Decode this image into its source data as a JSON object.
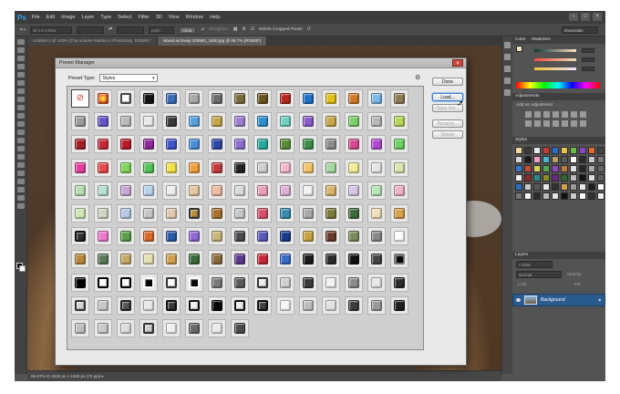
{
  "menubar": {
    "logo": "Ps",
    "items": [
      "File",
      "Edit",
      "Image",
      "Layer",
      "Type",
      "Select",
      "Filter",
      "3D",
      "View",
      "Window",
      "Help"
    ]
  },
  "optbar": {
    "size_value": "W x H x Res",
    "units": "px/in",
    "clear_label": "Clear",
    "straighten_label": "Straighten",
    "delete_cropped_label": "Delete Cropped Pixels",
    "workspace": "Essentials"
  },
  "tabs": [
    {
      "label": "Untitled-1 @ 100% (The Actions Palette in Photoshop, RGB/8) *"
    },
    {
      "label": "island archway 300582_1920.jpg @ 66.7% (RGB/8*)"
    }
  ],
  "status": {
    "text": "66.67%  ⊡  1920 px x 1280 px (72 ppi)  ▸"
  },
  "panels": {
    "color_tabs": [
      "Color",
      "Swatches"
    ],
    "adjustments_title": "Adjustments",
    "adjustments_hint": "Add an adjustment",
    "styles_title": "Styles",
    "layers_title": "Layers",
    "layers_kind": "⌕ Kind",
    "layers_blend": "Normal",
    "layers_opacity": "Opacity:",
    "layers_lock": "Lock:",
    "layers_fill": "Fill:",
    "layer_name": "Background"
  },
  "dialog": {
    "title": "Preset Manager",
    "preset_type_label": "Preset Type:",
    "preset_type_value": "Styles",
    "buttons": {
      "done": "Done",
      "load": "Load...",
      "save_set": "Save Set...",
      "rename": "Rename...",
      "delete": "Delete"
    },
    "presets": [
      {
        "kind": "none",
        "fill": "#ffffff"
      },
      {
        "fill": "#d8481f",
        "glow": "#ffd23a"
      },
      {
        "fill": "#ffffff",
        "border": "#444444"
      },
      {
        "fill": "#111111"
      },
      {
        "fill": "#3b6db5"
      },
      {
        "fill": "#a5a5a5"
      },
      {
        "fill": "#6e6e6e"
      },
      {
        "fill": "#7a6a3b"
      },
      {
        "fill": "#6a5420"
      },
      {
        "fill": "#b5261e"
      },
      {
        "fill": "#1f6fc7"
      },
      {
        "fill": "#e3c21a"
      },
      {
        "fill": "#d27a2a"
      },
      {
        "fill": "#7cb7e6"
      },
      {
        "fill": "#8e7a55"
      },
      {
        "fill": "#9c9c9c"
      },
      {
        "fill": "#6456c8"
      },
      {
        "fill": "#b9b9b9"
      },
      {
        "fill": "#eaeaea"
      },
      {
        "fill": "#3a3a3a"
      },
      {
        "fill": "#5aa0dc"
      },
      {
        "fill": "#c7a54a"
      },
      {
        "fill": "#9b7fd0"
      },
      {
        "fill": "#2e8fd0"
      },
      {
        "fill": "#6fd0c0"
      },
      {
        "fill": "#8a5cc8"
      },
      {
        "fill": "#c8a84a"
      },
      {
        "fill": "#7ed06a"
      },
      {
        "fill": "#b8b8b8"
      },
      {
        "fill": "#b6d65a"
      },
      {
        "fill": "#a31f2b"
      },
      {
        "fill": "#c7283a"
      },
      {
        "fill": "#b81a28"
      },
      {
        "fill": "#8c2a9a"
      },
      {
        "fill": "#3f54c8"
      },
      {
        "fill": "#4a8fd6"
      },
      {
        "fill": "#2b46a8"
      },
      {
        "fill": "#8c6fd0"
      },
      {
        "fill": "#2aa8a0"
      },
      {
        "fill": "#5b8c3a"
      },
      {
        "fill": "#3d8f4a"
      },
      {
        "fill": "#8d8d8d"
      },
      {
        "fill": "#d64a8f"
      },
      {
        "fill": "#b04ad0"
      },
      {
        "fill": "#6fd066"
      },
      {
        "fill": "#e53f9d"
      },
      {
        "fill": "#e94a4a"
      },
      {
        "fill": "#7fd65a"
      },
      {
        "fill": "#56c456"
      },
      {
        "fill": "#f2e34a"
      },
      {
        "fill": "#f0a03a"
      },
      {
        "fill": "#c43a3a"
      },
      {
        "fill": "#222222"
      },
      {
        "fill": "#cfcfcf"
      },
      {
        "fill": "#f5b8cf"
      },
      {
        "fill": "#f4c46a"
      },
      {
        "fill": "#a5d9a0"
      },
      {
        "fill": "#f4ee9a"
      },
      {
        "fill": "#e7e7e7"
      },
      {
        "fill": "#d9e8b0"
      },
      {
        "fill": "#b7dcb0"
      },
      {
        "fill": "#b7e0d2"
      },
      {
        "fill": "#c9a8d8"
      },
      {
        "fill": "#b7d4ef"
      },
      {
        "fill": "#eeeeee"
      },
      {
        "fill": "#e6c6a0"
      },
      {
        "fill": "#f0bca0"
      },
      {
        "fill": "#dadada"
      },
      {
        "fill": "#e9a0b8"
      },
      {
        "fill": "#e0b0d8"
      },
      {
        "fill": "#f2f2f2"
      },
      {
        "fill": "#dab36a"
      },
      {
        "fill": "#d8c8e6"
      },
      {
        "fill": "#b8e6b8"
      },
      {
        "fill": "#f0b2c8"
      },
      {
        "fill": "#cfe6b5"
      },
      {
        "fill": "#cfd6c0"
      },
      {
        "fill": "#b6c8e6"
      },
      {
        "fill": "#c6c6c6"
      },
      {
        "fill": "#e0cbb0"
      },
      {
        "fill": "#b98a3a",
        "border": "#333333"
      },
      {
        "fill": "#a6722e"
      },
      {
        "fill": "#c6c6c6"
      },
      {
        "fill": "#d6536a"
      },
      {
        "fill": "#3a8ab0"
      },
      {
        "fill": "#a9a9a9"
      },
      {
        "fill": "#7a7a3a"
      },
      {
        "fill": "#3c6a3c"
      },
      {
        "fill": "#f0e0b8"
      },
      {
        "fill": "#d6a24a"
      },
      {
        "fill": "#333333",
        "border": "#111111"
      },
      {
        "fill": "#f07ad0"
      },
      {
        "fill": "#5aa04a"
      },
      {
        "fill": "#d86a2a"
      },
      {
        "fill": "#2a5aa8"
      },
      {
        "fill": "#8f6ad0"
      },
      {
        "fill": "#c8b87a"
      },
      {
        "fill": "#4a4a4a"
      },
      {
        "fill": "#5a5ab8"
      },
      {
        "fill": "#1a3a8a"
      },
      {
        "fill": "#c8a040"
      },
      {
        "fill": "#6a3a2a"
      },
      {
        "fill": "#7a8a5a"
      },
      {
        "fill": "#888888"
      },
      {
        "fill": "#ffffff"
      },
      {
        "fill": "#b8863a"
      },
      {
        "fill": "#5a7a5a"
      },
      {
        "fill": "#c8a86a"
      },
      {
        "fill": "#e8e0b0"
      },
      {
        "fill": "#cfa050"
      },
      {
        "fill": "#3a6a3a"
      },
      {
        "fill": "#8a6a3a"
      },
      {
        "fill": "#5a3a8a"
      },
      {
        "fill": "#c8283a"
      },
      {
        "fill": "#3a6ac8"
      },
      {
        "fill": "#1a1a1a"
      },
      {
        "fill": "#2a2a2a"
      },
      {
        "fill": "#111111"
      },
      {
        "fill": "#444444"
      },
      {
        "fill": "#000000",
        "border": "#777777"
      },
      {
        "fill": "#000000"
      },
      {
        "fill": "#ffffff",
        "border": "#000000"
      },
      {
        "fill": "#ffffff",
        "border": "#000000"
      },
      {
        "fill": "#000000",
        "border": "#ffffff"
      },
      {
        "fill": "#ffffff",
        "border": "#333333"
      },
      {
        "fill": "#000000",
        "border": "#ffffff"
      },
      {
        "fill": "#7a7a7a"
      },
      {
        "fill": "#5a5a5a"
      },
      {
        "fill": "#eeeeee",
        "border": "#333333"
      },
      {
        "fill": "#d0d0d0"
      },
      {
        "fill": "#3a3a3a"
      },
      {
        "fill": "#f2f2f2"
      },
      {
        "fill": "#8c8c8c"
      },
      {
        "fill": "#e6e6e6"
      },
      {
        "fill": "#2a2a2a"
      },
      {
        "fill": "#d6d6d6",
        "border": "#333333"
      },
      {
        "fill": "#c8c8c8"
      },
      {
        "fill": "#555555",
        "border": "#222222"
      },
      {
        "fill": "#e8e8e8"
      },
      {
        "fill": "#3a3a3a",
        "border": "#111111"
      },
      {
        "fill": "#f0f0f0",
        "border": "#111111"
      },
      {
        "fill": "#000000"
      },
      {
        "fill": "#eeeeee",
        "border": "#111111"
      },
      {
        "fill": "#444444",
        "border": "#111111"
      },
      {
        "fill": "#f5f5f5"
      },
      {
        "fill": "#bdbdbd"
      },
      {
        "fill": "#e2e2e2"
      },
      {
        "fill": "#3e3e3e"
      },
      {
        "fill": "#9a9a9a"
      },
      {
        "fill": "#1e1e1e"
      },
      {
        "fill": "#bfbfbf"
      },
      {
        "fill": "#c8c8c8"
      },
      {
        "fill": "#dddddd"
      },
      {
        "fill": "#cfcfcf",
        "border": "#333333"
      },
      {
        "fill": "#f0f0f0"
      },
      {
        "fill": "#6a6a6a"
      },
      {
        "fill": "#ececec"
      },
      {
        "fill": "#4a4a4a"
      }
    ]
  },
  "styles_swatches": [
    "#f4d7a1",
    "#3a3a3a",
    "#e9e9e9",
    "#c93c3c",
    "#2d6ec4",
    "#e8c24a",
    "#6fb84a",
    "#8a4ac8",
    "#e26a2a",
    "#444444",
    "#d6d6d6",
    "#1a1a1a",
    "#f2a0c8",
    "#4ab8c8",
    "#b8a06a",
    "#5a5a5a",
    "#ffffff",
    "#2a2a2a",
    "#c8c8c8",
    "#7a7a7a",
    "#3c78c8",
    "#c8483c",
    "#d8d058",
    "#52a852",
    "#904ac0",
    "#c07a3a",
    "#e0e0e0",
    "#262626",
    "#aaaaaa",
    "#666666",
    "#f0f0f0",
    "#8c2a2a",
    "#2a8c8c",
    "#8c8c2a",
    "#6a2a8c",
    "#2a6a2a",
    "#bcbcbc",
    "#121212",
    "#dcdcdc",
    "#5e5e5e",
    "#2d6ec4",
    "#c8c8c8",
    "#585858",
    "#eaeaea",
    "#303030",
    "#d0a050",
    "#9a9a9a",
    "#e8e8e8",
    "#1c1c1c",
    "#ffffff",
    "#777777",
    "#f4f4f4",
    "#2c2c2c",
    "#bbbbbb",
    "#e5e5e5",
    "#111111",
    "#cccccc",
    "#ffffff",
    "#333333",
    "#eeeeee"
  ]
}
